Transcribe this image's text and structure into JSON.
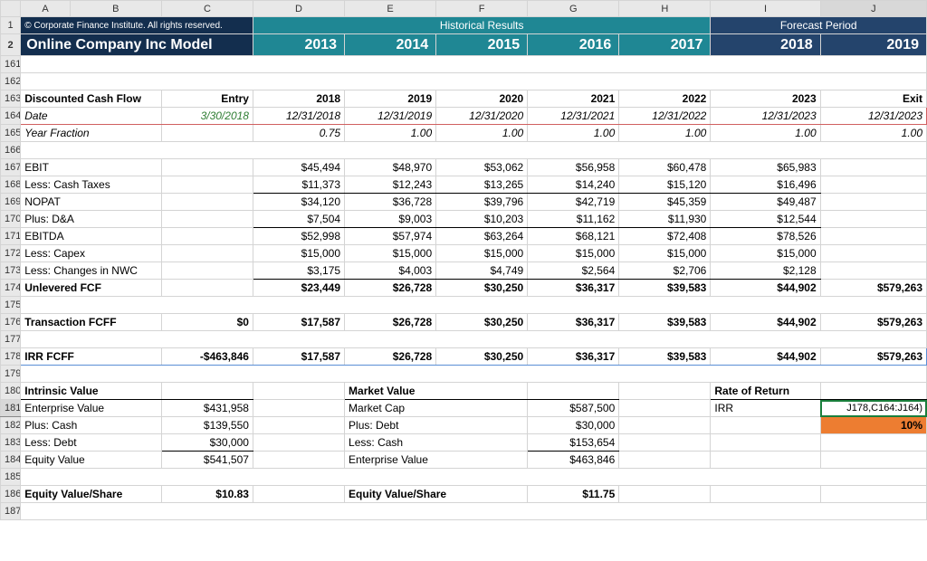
{
  "colHeaders": [
    "A",
    "B",
    "C",
    "D",
    "E",
    "F",
    "G",
    "H",
    "I",
    "J"
  ],
  "copyright": "© Corporate Finance Institute. All rights reserved.",
  "title": "Online Company Inc Model",
  "historicalLabel": "Historical Results",
  "forecastLabel": "Forecast Period",
  "years": [
    "2013",
    "2014",
    "2015",
    "2016",
    "2017",
    "2018",
    "2019"
  ],
  "dcfHeader": {
    "label": "Discounted Cash Flow",
    "c": "Entry",
    "d": "2018",
    "e": "2019",
    "f": "2020",
    "g": "2021",
    "h": "2022",
    "i": "2023",
    "j": "Exit"
  },
  "dateRow": {
    "label": "Date",
    "c": "3/30/2018",
    "d": "12/31/2018",
    "e": "12/31/2019",
    "f": "12/31/2020",
    "g": "12/31/2021",
    "h": "12/31/2022",
    "i": "12/31/2023",
    "j": "12/31/2023"
  },
  "yearFrac": {
    "label": "Year Fraction",
    "d": "0.75",
    "e": "1.00",
    "f": "1.00",
    "g": "1.00",
    "h": "1.00",
    "i": "1.00",
    "j": "1.00"
  },
  "ebit": {
    "label": "EBIT",
    "d": "$45,494",
    "e": "$48,970",
    "f": "$53,062",
    "g": "$56,958",
    "h": "$60,478",
    "i": "$65,983"
  },
  "taxes": {
    "label": "Less: Cash Taxes",
    "d": "$11,373",
    "e": "$12,243",
    "f": "$13,265",
    "g": "$14,240",
    "h": "$15,120",
    "i": "$16,496"
  },
  "nopat": {
    "label": "NOPAT",
    "d": "$34,120",
    "e": "$36,728",
    "f": "$39,796",
    "g": "$42,719",
    "h": "$45,359",
    "i": "$49,487"
  },
  "da": {
    "label": "Plus: D&A",
    "d": "$7,504",
    "e": "$9,003",
    "f": "$10,203",
    "g": "$11,162",
    "h": "$11,930",
    "i": "$12,544"
  },
  "ebitda": {
    "label": "EBITDA",
    "d": "$52,998",
    "e": "$57,974",
    "f": "$63,264",
    "g": "$68,121",
    "h": "$72,408",
    "i": "$78,526"
  },
  "capex": {
    "label": "Less: Capex",
    "d": "$15,000",
    "e": "$15,000",
    "f": "$15,000",
    "g": "$15,000",
    "h": "$15,000",
    "i": "$15,000"
  },
  "nwc": {
    "label": "Less: Changes in NWC",
    "d": "$3,175",
    "e": "$4,003",
    "f": "$4,749",
    "g": "$2,564",
    "h": "$2,706",
    "i": "$2,128"
  },
  "ufcf": {
    "label": "Unlevered FCF",
    "d": "$23,449",
    "e": "$26,728",
    "f": "$30,250",
    "g": "$36,317",
    "h": "$39,583",
    "i": "$44,902",
    "j": "$579,263"
  },
  "tfcff": {
    "label": "Transaction FCFF",
    "c": "$0",
    "d": "$17,587",
    "e": "$26,728",
    "f": "$30,250",
    "g": "$36,317",
    "h": "$39,583",
    "i": "$44,902",
    "j": "$579,263"
  },
  "irrfcff": {
    "label": "IRR FCFF",
    "c": "-$463,846",
    "d": "$17,587",
    "e": "$26,728",
    "f": "$30,250",
    "g": "$36,317",
    "h": "$39,583",
    "i": "$44,902",
    "j": "$579,263"
  },
  "intrinsic": {
    "header": "Intrinsic Value",
    "ev": {
      "label": "Enterprise Value",
      "val": "$431,958"
    },
    "cash": {
      "label": "Plus: Cash",
      "val": "$139,550"
    },
    "debt": {
      "label": "Less: Debt",
      "val": "$30,000"
    },
    "equity": {
      "label": "Equity Value",
      "val": "$541,507"
    },
    "pershare": {
      "label": "Equity Value/Share",
      "val": "$10.83"
    }
  },
  "market": {
    "header": "Market Value",
    "cap": {
      "label": "Market Cap",
      "val": "$587,500"
    },
    "debt": {
      "label": "Plus: Debt",
      "val": "$30,000"
    },
    "cash": {
      "label": "Less: Cash",
      "val": "$153,654"
    },
    "ev": {
      "label": "Enterprise Value",
      "val": "$463,846"
    },
    "pershare": {
      "label": "Equity Value/Share",
      "val": "$11.75"
    }
  },
  "ror": {
    "header": "Rate of Return",
    "irrLabel": "IRR",
    "formula": "J178,C164:J164)",
    "irrVal": "10%"
  },
  "rowNums": {
    "r161": "161",
    "r162": "162",
    "r163": "163",
    "r164": "164",
    "r165": "165",
    "r166": "166",
    "r167": "167",
    "r168": "168",
    "r169": "169",
    "r170": "170",
    "r171": "171",
    "r172": "172",
    "r173": "173",
    "r174": "174",
    "r175": "175",
    "r176": "176",
    "r177": "177",
    "r178": "178",
    "r179": "179",
    "r180": "180",
    "r181": "181",
    "r182": "182",
    "r183": "183",
    "r184": "184",
    "r185": "185",
    "r186": "186",
    "r187": "187"
  }
}
